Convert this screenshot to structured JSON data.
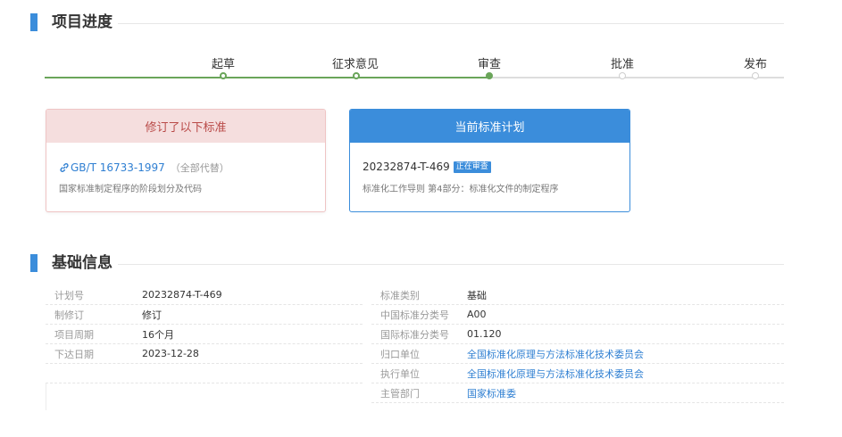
{
  "progress": {
    "title": "项目进度",
    "steps": [
      {
        "label": "起草",
        "status": "done"
      },
      {
        "label": "征求意见",
        "status": "done"
      },
      {
        "label": "审查",
        "status": "current"
      },
      {
        "label": "批准",
        "status": "todo"
      },
      {
        "label": "发布",
        "status": "todo"
      }
    ]
  },
  "revised_card": {
    "header": "修订了以下标准",
    "code": "GB/T 16733-1997",
    "note": "（全部代替）",
    "name": "国家标准制定程序的阶段划分及代码"
  },
  "current_card": {
    "header": "当前标准计划",
    "code": "20232874-T-469",
    "badge": "正在审查",
    "name": "标准化工作导则 第4部分：标准化文件的制定程序"
  },
  "basic_info": {
    "title": "基础信息",
    "left": [
      {
        "label": "计划号",
        "value": "20232874-T-469"
      },
      {
        "label": "制修订",
        "value": "修订"
      },
      {
        "label": "项目周期",
        "value": "16个月"
      },
      {
        "label": "下达日期",
        "value": "2023-12-28"
      }
    ],
    "right": [
      {
        "label": "标准类别",
        "value": "基础"
      },
      {
        "label": "中国标准分类号",
        "value": "A00"
      },
      {
        "label": "国际标准分类号",
        "value": "01.120"
      },
      {
        "label": "归口单位",
        "value": "全国标准化原理与方法标准化技术委员会"
      },
      {
        "label": "执行单位",
        "value": "全国标准化原理与方法标准化技术委员会"
      },
      {
        "label": "主管部门",
        "value": "国家标准委"
      }
    ]
  },
  "colors": {
    "accent": "#3b8ddb",
    "progress_done": "#6aa55a",
    "revised_header_bg": "#f5dede",
    "revised_header_text": "#b94a48",
    "link": "#2f7fd2"
  }
}
